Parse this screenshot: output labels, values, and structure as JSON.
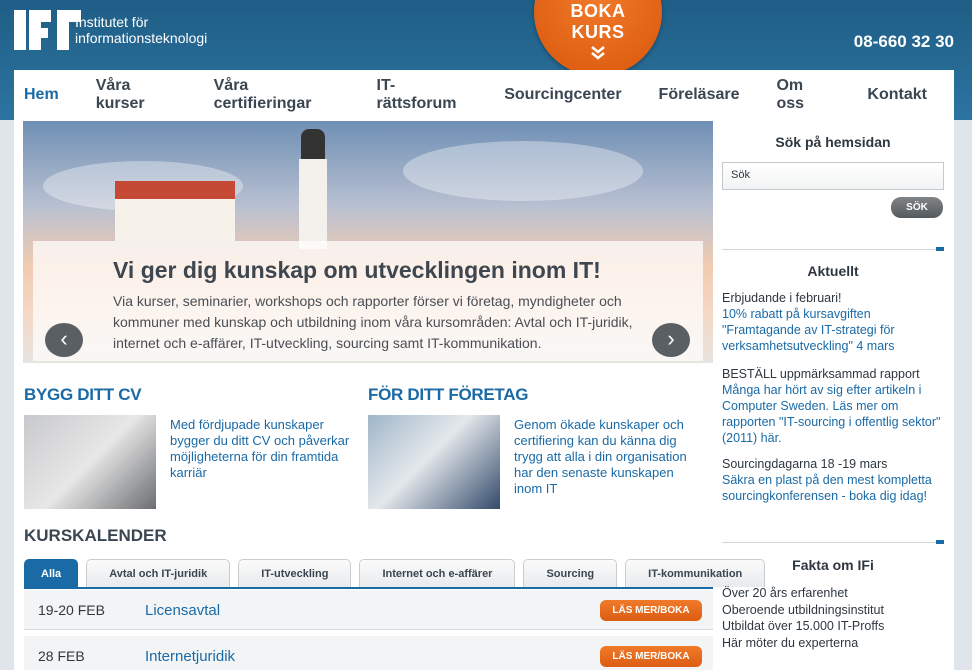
{
  "header": {
    "logo_mark": "IFI",
    "logo_line1": "Institutet för",
    "logo_line2": "informationsteknologi",
    "phone": "08-660 32 30",
    "boka_line1": "BOKA",
    "boka_line2": "KURS",
    "boka_icon": "double-chevron-down-icon"
  },
  "nav": {
    "items": [
      "Hem",
      "Våra kurser",
      "Våra certifieringar",
      "IT-rättsforum",
      "Sourcingcenter",
      "Föreläsare",
      "Om oss",
      "Kontakt"
    ]
  },
  "hero": {
    "title": "Vi ger dig kunskap om utvecklingen inom IT!",
    "text": "Via kurser, seminarier, workshops och rapporter förser vi företag, myndigheter och kommuner med kunskap och utbildning inom våra kursområden: Avtal och IT-juridik, internet och e-affärer, IT-utveckling, sourcing samt IT-kommunikation.",
    "prev": "‹",
    "next": "›"
  },
  "promo": {
    "cv_title": "BYGG DITT CV",
    "cv_text": "Med fördjupade kunskaper bygger du ditt CV och påverkar möjligheterna för din framtida karriär",
    "company_title": "FÖR DITT FÖRETAG",
    "company_text": "Genom ökade kunskaper och certifiering kan du känna dig trygg att alla i din organisation har den senaste kunskapen inom IT"
  },
  "calendar": {
    "title": "KURSKALENDER",
    "tabs": [
      "Alla",
      "Avtal och IT-juridik",
      "IT-utveckling",
      "Internet och e-affärer",
      "Sourcing",
      "IT-kommunikation"
    ],
    "rows": [
      {
        "date": "19-20 FEB",
        "title": "Licensavtal",
        "button": "LÄS MER/BOKA"
      },
      {
        "date": "28 FEB",
        "title": "Internetjuridik",
        "button": "LÄS MER/BOKA"
      }
    ]
  },
  "sidebar": {
    "search_title": "Sök på hemsidan",
    "search_value": "Sök",
    "search_button": "SÖK",
    "news_title": "Aktuellt",
    "news": [
      {
        "heading": "Erbjudande i februari!",
        "body": "10% rabatt på kursavgiften \"Framtagande av IT-strategi för verksamhetsutveckling\" 4 mars"
      },
      {
        "heading": "BESTÄLL uppmärksammad rapport",
        "body": "Många har hört av sig efter artikeln i Computer Sweden. Läs mer om rapporten \"IT-sourcing i offentlig sektor\" (2011) här."
      },
      {
        "heading": "Sourcingdagarna 18 -19 mars",
        "body": "Säkra en plast på den mest kompletta sourcingkonferensen - boka dig idag!"
      }
    ],
    "facts_title": "Fakta om IFi",
    "facts": [
      "Över 20 års erfarenhet",
      "Oberoende utbildningsinstitut",
      "Utbildat över 15.000 IT-Proffs",
      "Här möter du experterna"
    ]
  }
}
